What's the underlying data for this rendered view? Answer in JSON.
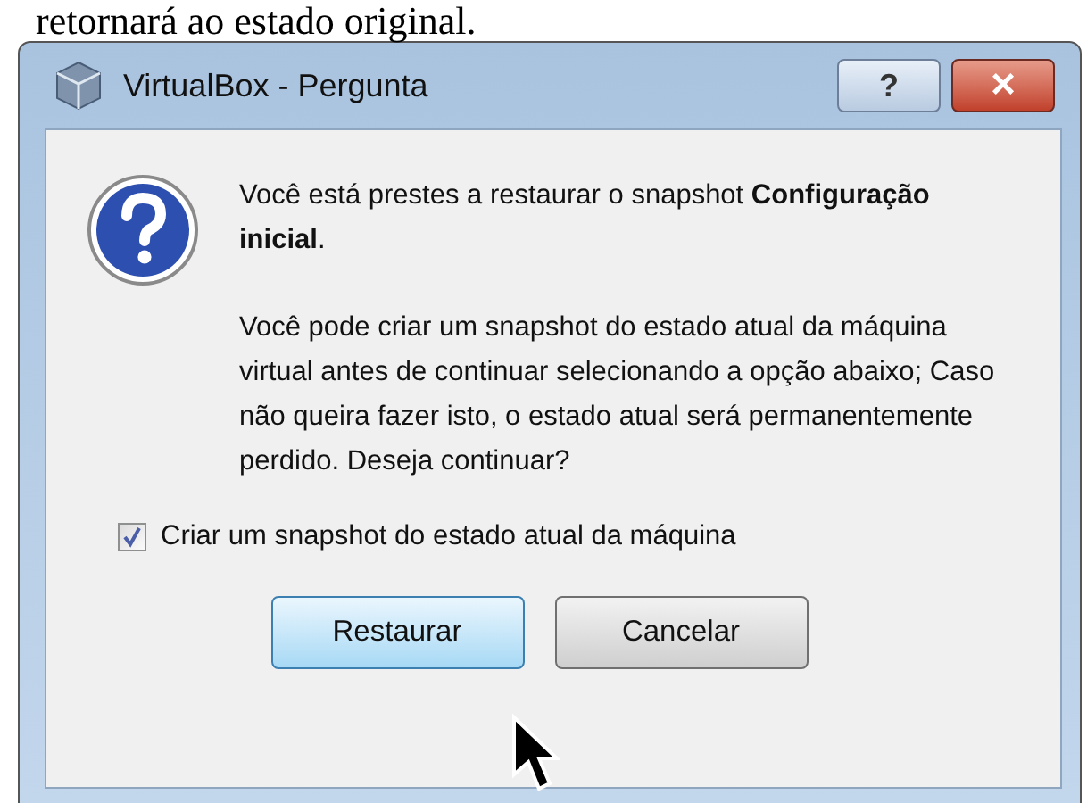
{
  "background_text": "retornará ao estado original.",
  "window": {
    "title": "VirtualBox - Pergunta",
    "help_button": "?",
    "close_button": "×"
  },
  "message": {
    "lines": [
      "Você está prestes a restaurar o snapshot **Configuração inicial**.",
      "Você pode criar um snapshot do estado atual da máquina virtual antes de continuar selecionando a opção abaixo; Caso não queira fazer isto, o estado atual será permanentemente perdido. Deseja continuar?"
    ]
  },
  "checkbox": {
    "label": "Criar um snapshot do estado atual da máquina",
    "checked": true
  },
  "buttons": [
    {
      "label": "Restaurar",
      "hovered": true
    },
    {
      "label": "Cancelar",
      "hovered": false
    }
  ]
}
